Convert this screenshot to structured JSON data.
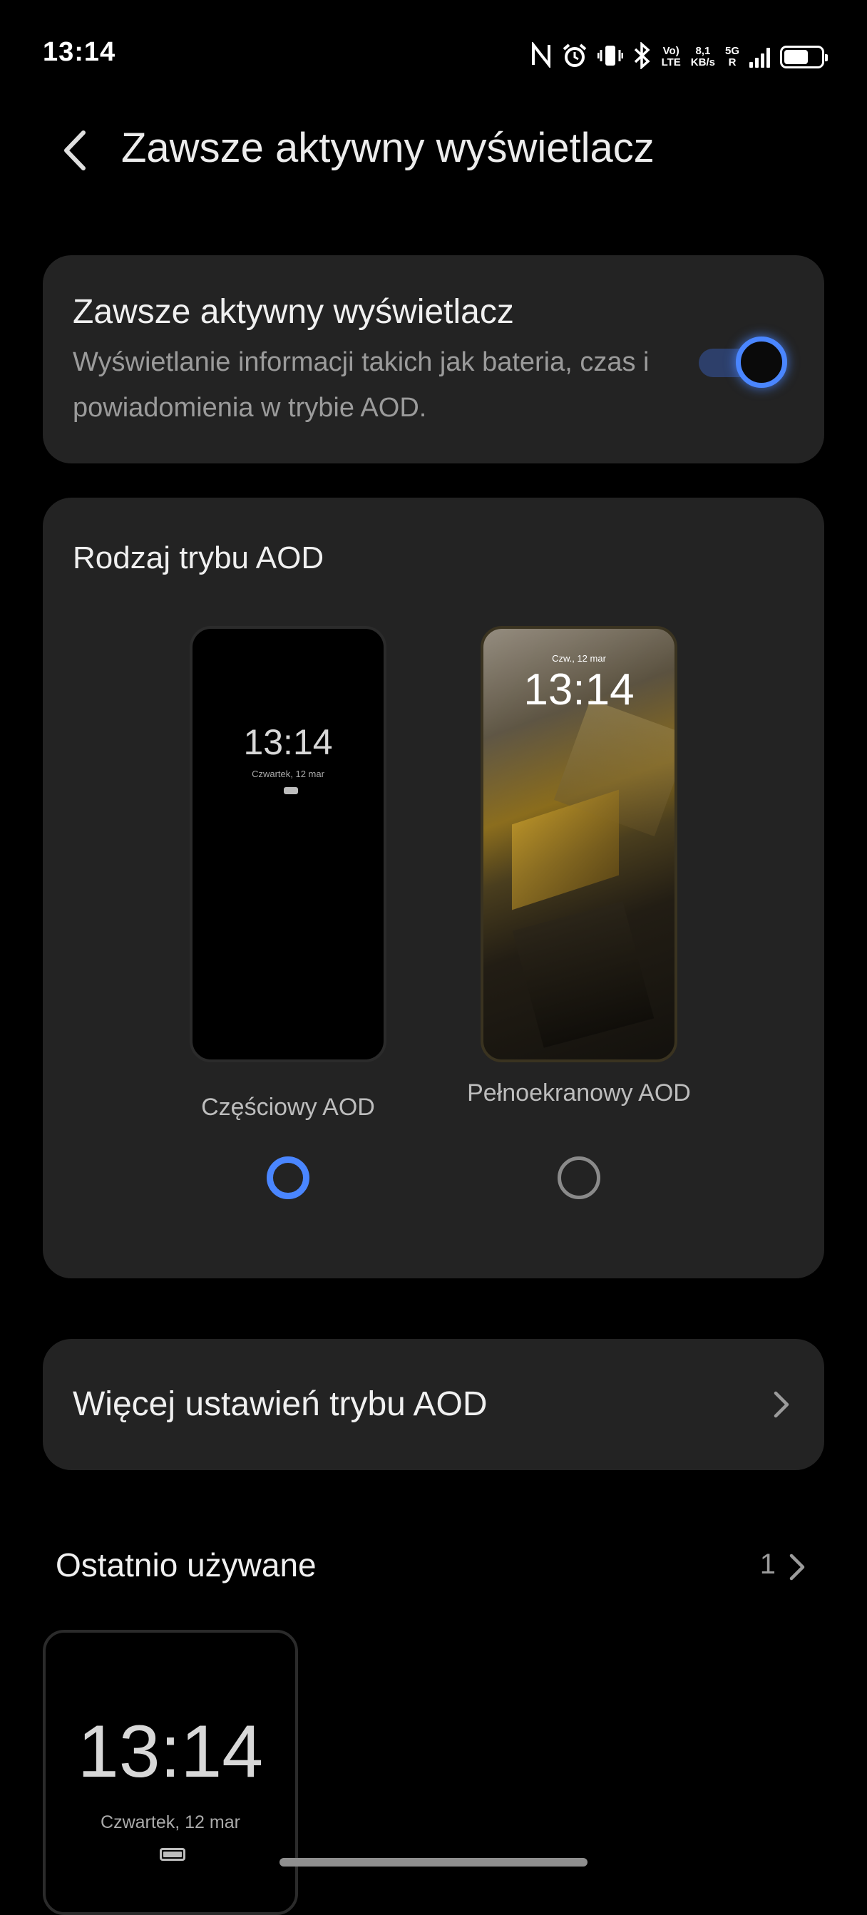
{
  "status_bar": {
    "time": "13:14",
    "network_top": "Vo)",
    "network_bottom": "LTE",
    "speed_value": "8,1",
    "speed_unit": "KB/s",
    "gen_top": "5G",
    "gen_bottom": "R"
  },
  "header": {
    "title": "Zawsze aktywny wyświetlacz"
  },
  "aod_toggle": {
    "title": "Zawsze aktywny wyświetlacz",
    "description": "Wyświetlanie informacji takich jak bateria, czas i powiadomienia w trybie AOD.",
    "enabled": true
  },
  "aod_mode": {
    "title": "Rodzaj trybu AOD",
    "options": [
      {
        "label": "Częściowy AOD",
        "selected": true,
        "preview_time": "13:14",
        "preview_date": "Czwartek, 12 mar"
      },
      {
        "label": "Pełnoekranowy AOD",
        "selected": false,
        "preview_time": "13:14",
        "preview_date": "Czw., 12 mar"
      }
    ]
  },
  "more_settings": {
    "label": "Więcej ustawień trybu AOD"
  },
  "recent": {
    "title": "Ostatnio używane",
    "count": "1",
    "items": [
      {
        "time": "13:14",
        "date": "Czwartek, 12 mar"
      }
    ]
  },
  "colors": {
    "accent": "#4a86ff",
    "background": "#000000",
    "card": "#232323"
  }
}
